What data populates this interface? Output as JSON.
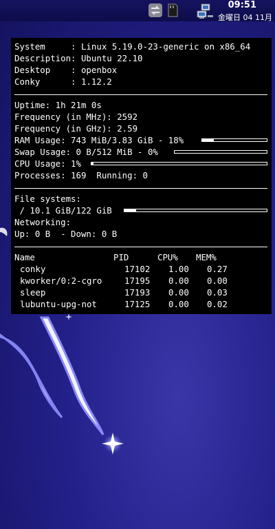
{
  "panel": {
    "time": "09:51",
    "date": "金曜日 04 11月",
    "tray_icons": [
      "switch-icon",
      "memory-card-icon",
      "network-icon"
    ]
  },
  "conky": {
    "system": {
      "system": "System     : Linux 5.19.0-23-generic on x86_64",
      "description": "Description: Ubuntu 22.10",
      "desktop": "Desktop    : openbox",
      "conky": "Conky      : 1.12.2"
    },
    "stats": {
      "uptime": "Uptime: 1h 21m 0s",
      "freq_mhz": "Frequency (in MHz): 2592",
      "freq_ghz": "Frequency (in GHz): 2.59",
      "ram": "RAM Usage: 743 MiB/3.83 GiB - 18%",
      "ram_percent": 18,
      "swap": "Swap Usage: 0 B/512 MiB - 0%",
      "swap_percent": 0,
      "cpu": "CPU Usage: 1%",
      "cpu_percent": 1,
      "processes": "Processes: 169  Running: 0"
    },
    "fs": {
      "label": "File systems:",
      "root": " / 10.1 GiB/122 GiB",
      "root_percent": 8,
      "networking": "Networking:",
      "updown": "Up: 0 B  - Down: 0 B"
    },
    "table": {
      "headers": {
        "name": "Name",
        "pid": "PID",
        "cpu": "CPU%",
        "mem": "MEM%"
      },
      "rows": [
        {
          "name": "conky",
          "pid": "17102",
          "cpu": "1.00",
          "mem": "0.27"
        },
        {
          "name": "kworker/0:2-cgro",
          "pid": "17195",
          "cpu": "0.00",
          "mem": "0.00"
        },
        {
          "name": "sleep",
          "pid": "17193",
          "cpu": "0.00",
          "mem": "0.03"
        },
        {
          "name": "lubuntu-upg-not",
          "pid": "17125",
          "cpu": "0.00",
          "mem": "0.02"
        }
      ]
    }
  }
}
